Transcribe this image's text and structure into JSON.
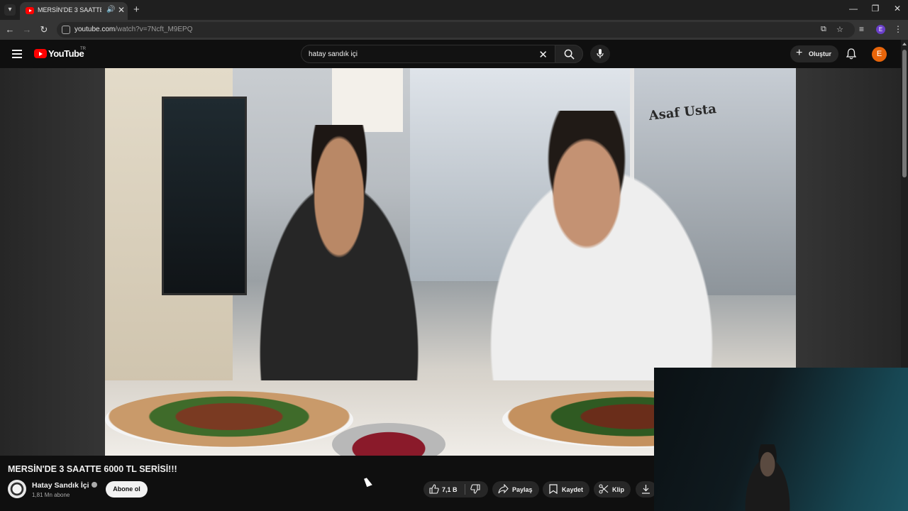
{
  "browser": {
    "tab_title": "MERSİN'DE 3 SAATTE 6000",
    "url_host": "youtube.com",
    "url_path": "/watch?v=7Ncft_M9EPQ"
  },
  "masthead": {
    "logo_text": "YouTube",
    "region": "TR",
    "search_query": "hatay sandık içi",
    "create_label": "Oluştur",
    "avatar_initial": "E"
  },
  "video": {
    "sign_text": "Asaf Usta"
  },
  "info": {
    "title": "MERSİN'DE 3 SAATTE 6000 TL SERİSİ!!!",
    "channel_name": "Hatay Sandık İçi",
    "subscribers": "1,81 Mn abone",
    "subscribe_label": "Abone ol"
  },
  "actions": {
    "likes": "7,1 B",
    "share_label": "Paylaş",
    "save_label": "Kaydet",
    "clip_label": "Klip"
  },
  "profile_initial": "E"
}
